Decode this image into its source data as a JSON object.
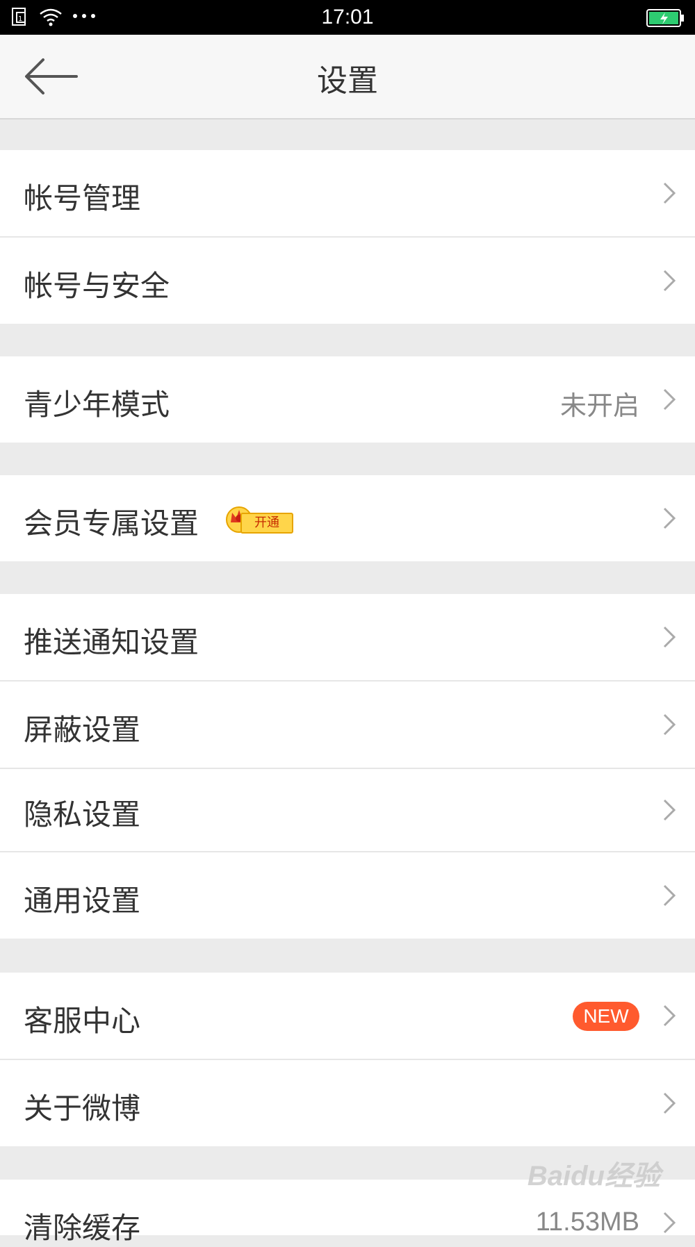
{
  "status_bar": {
    "time": "17:01",
    "icons": [
      "sim-icon",
      "wifi-icon",
      "more-dots-icon",
      "battery-charging-icon"
    ],
    "battery_color": "#2ecc71"
  },
  "header": {
    "title": "设置"
  },
  "groups": [
    {
      "items": [
        {
          "label": "帐号管理"
        },
        {
          "label": "帐号与安全"
        }
      ]
    },
    {
      "items": [
        {
          "label": "青少年模式",
          "value": "未开启"
        }
      ]
    },
    {
      "items": [
        {
          "label": "会员专属设置",
          "badge": "开通"
        }
      ]
    },
    {
      "items": [
        {
          "label": "推送通知设置"
        },
        {
          "label": "屏蔽设置"
        },
        {
          "label": "隐私设置"
        },
        {
          "label": "通用设置"
        }
      ]
    },
    {
      "items": [
        {
          "label": "客服中心",
          "badge": "NEW"
        },
        {
          "label": "关于微博"
        }
      ]
    },
    {
      "items": [
        {
          "label": "清除缓存",
          "value": "11.53MB"
        }
      ]
    }
  ],
  "colors": {
    "accent": "#ff5a2e",
    "background": "#ebebeb",
    "row": "#ffffff",
    "text": "#333333",
    "secondary_text": "#888888"
  },
  "watermark": "Baidu经验"
}
